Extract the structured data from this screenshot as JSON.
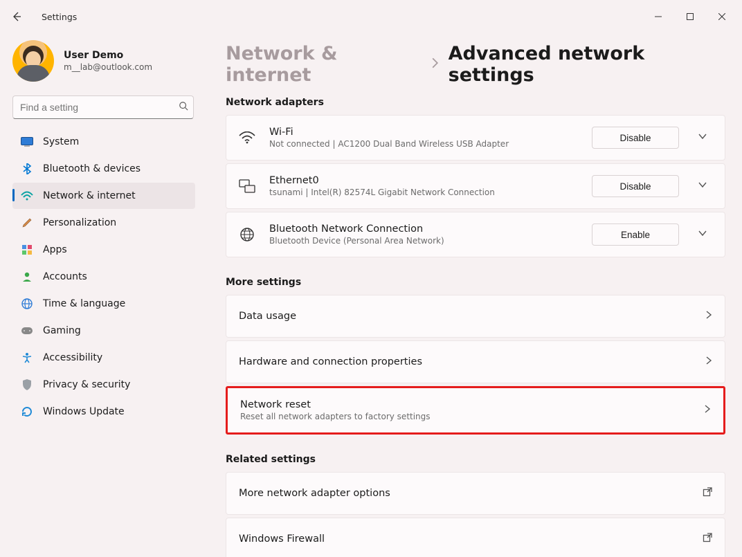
{
  "titlebar": {
    "app_title": "Settings"
  },
  "user": {
    "name": "User Demo",
    "email": "m__lab@outlook.com"
  },
  "search": {
    "placeholder": "Find a setting"
  },
  "nav": {
    "items": [
      {
        "label": "System"
      },
      {
        "label": "Bluetooth & devices"
      },
      {
        "label": "Network & internet"
      },
      {
        "label": "Personalization"
      },
      {
        "label": "Apps"
      },
      {
        "label": "Accounts"
      },
      {
        "label": "Time & language"
      },
      {
        "label": "Gaming"
      },
      {
        "label": "Accessibility"
      },
      {
        "label": "Privacy & security"
      },
      {
        "label": "Windows Update"
      }
    ]
  },
  "breadcrumb": {
    "parent": "Network & internet",
    "current": "Advanced network settings"
  },
  "sections": {
    "adapters_title": "Network adapters",
    "more_title": "More settings",
    "related_title": "Related settings"
  },
  "adapters": [
    {
      "title": "Wi-Fi",
      "subtitle": "Not connected | AC1200  Dual Band Wireless USB Adapter",
      "action": "Disable"
    },
    {
      "title": "Ethernet0",
      "subtitle": "tsunami | Intel(R) 82574L Gigabit Network Connection",
      "action": "Disable"
    },
    {
      "title": "Bluetooth Network Connection",
      "subtitle": "Bluetooth Device (Personal Area Network)",
      "action": "Enable"
    }
  ],
  "more": [
    {
      "title": "Data usage",
      "subtitle": ""
    },
    {
      "title": "Hardware and connection properties",
      "subtitle": ""
    },
    {
      "title": "Network reset",
      "subtitle": "Reset all network adapters to factory settings"
    }
  ],
  "related": [
    {
      "title": "More network adapter options"
    },
    {
      "title": "Windows Firewall"
    }
  ]
}
